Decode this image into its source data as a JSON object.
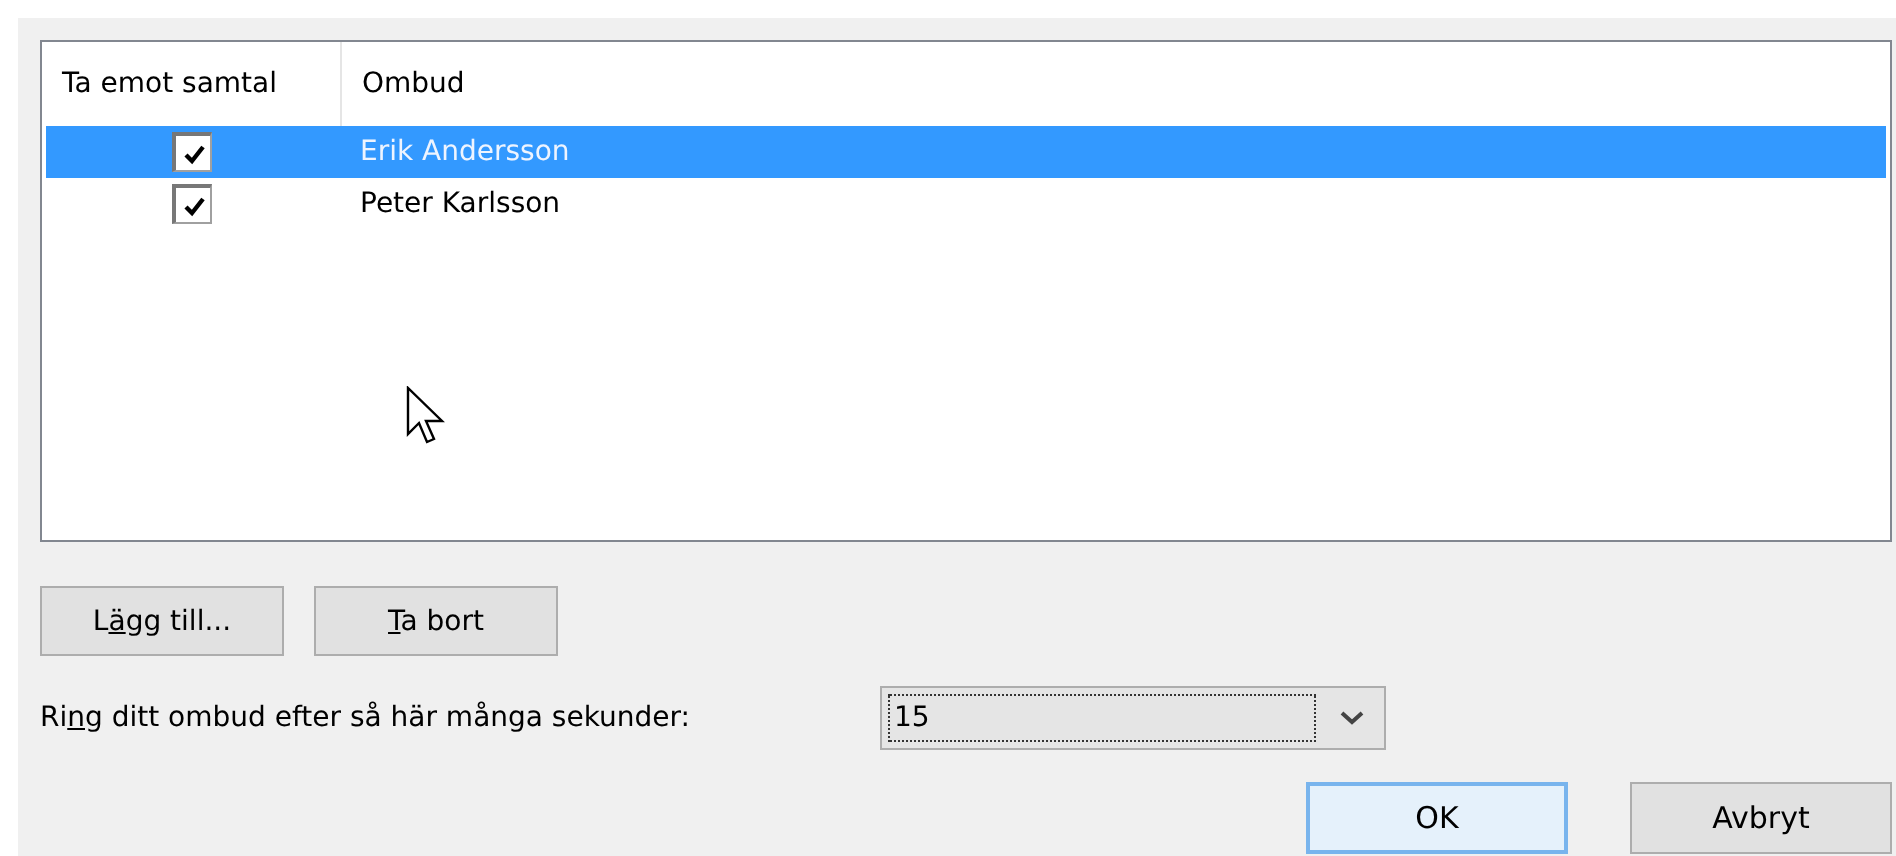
{
  "table": {
    "columns": [
      "Ta emot samtal",
      "Ombud"
    ],
    "rows": [
      {
        "checked": true,
        "name": "Erik Andersson",
        "selected": true
      },
      {
        "checked": true,
        "name": "Peter Karlsson",
        "selected": false
      }
    ]
  },
  "list_buttons": [
    {
      "before": "L",
      "key": "ä",
      "after": "gg till..."
    },
    {
      "key": "T",
      "after": "a bort"
    }
  ],
  "ring_delay": {
    "label": {
      "before": "Ri",
      "key": "n",
      "after": "g ditt ombud efter så här många sekunder:"
    },
    "value": "15"
  },
  "dialog_buttons": [
    {
      "label": "OK",
      "default": true
    },
    {
      "label": "Avbryt",
      "default": false
    }
  ]
}
